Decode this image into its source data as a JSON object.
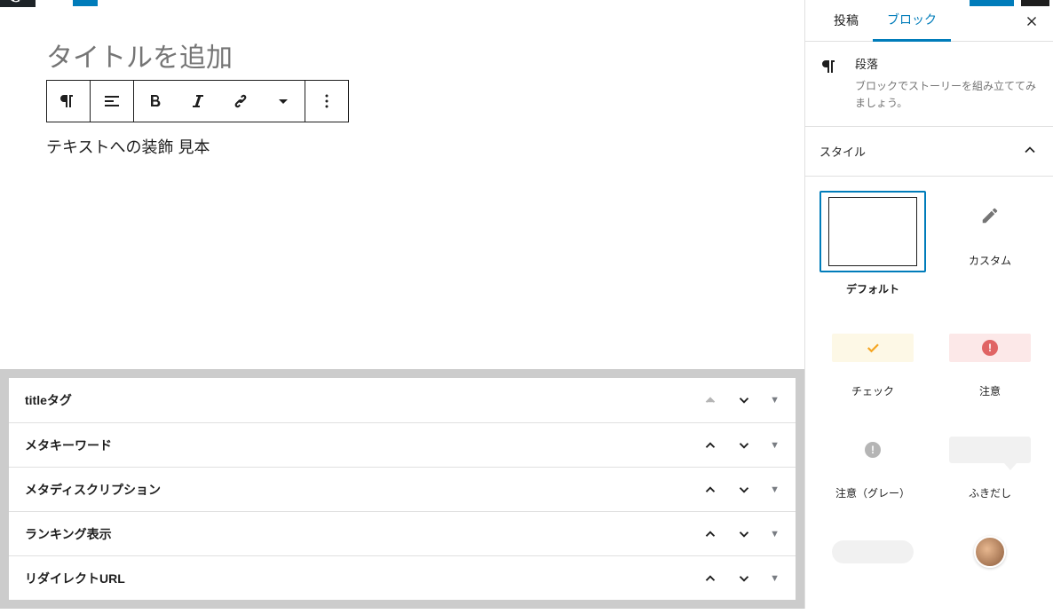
{
  "editor": {
    "title_placeholder": "タイトルを追加",
    "paragraph_text": "テキストへの装飾 見本"
  },
  "meta_boxes": [
    {
      "title": "titleタグ",
      "up_enabled": false,
      "down_enabled": true
    },
    {
      "title": "メタキーワード",
      "up_enabled": true,
      "down_enabled": true
    },
    {
      "title": "メタディスクリプション",
      "up_enabled": true,
      "down_enabled": true
    },
    {
      "title": "ランキング表示",
      "up_enabled": true,
      "down_enabled": true
    },
    {
      "title": "リダイレクトURL",
      "up_enabled": true,
      "down_enabled": true
    }
  ],
  "sidebar": {
    "tabs": {
      "post": "投稿",
      "block": "ブロック"
    },
    "block_info": {
      "title": "段落",
      "desc": "ブロックでストーリーを組み立ててみましょう。"
    },
    "panel_styles_title": "スタイル",
    "styles": [
      {
        "key": "default",
        "label": "デフォルト",
        "selected": true
      },
      {
        "key": "custom",
        "label": "カスタム",
        "selected": false
      },
      {
        "key": "check",
        "label": "チェック",
        "selected": false
      },
      {
        "key": "notice",
        "label": "注意",
        "selected": false
      },
      {
        "key": "notice_gray",
        "label": "注意（グレー）",
        "selected": false
      },
      {
        "key": "speech",
        "label": "ふきだし",
        "selected": false
      }
    ]
  },
  "colors": {
    "accent": "#007cba"
  }
}
